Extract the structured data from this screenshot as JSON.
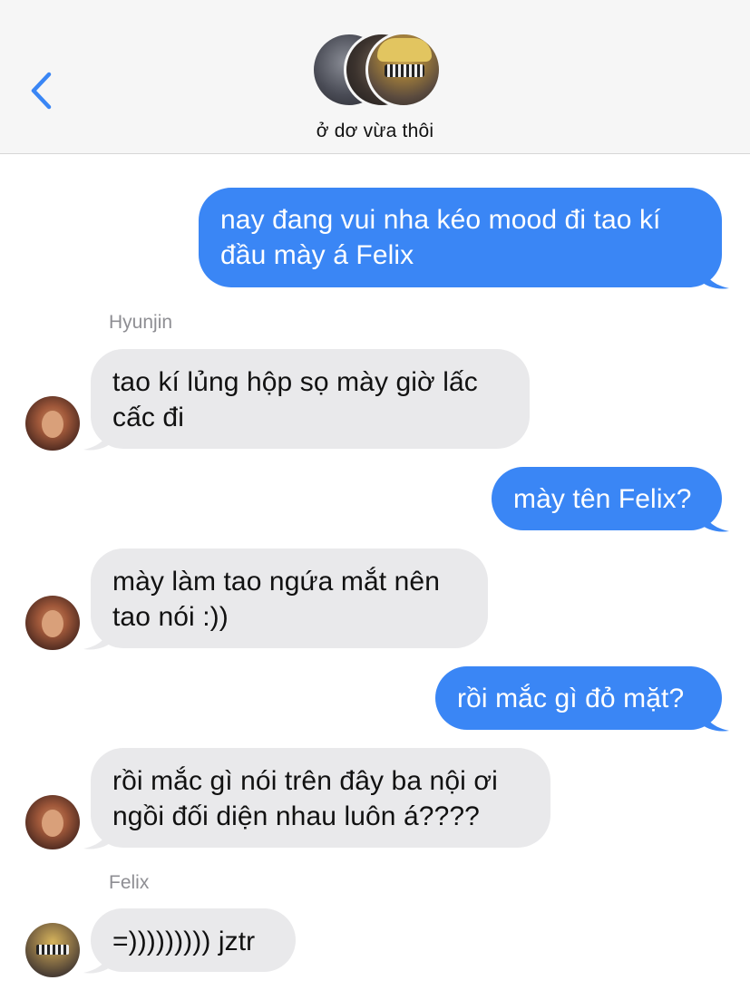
{
  "header": {
    "group_name": "ở dơ vừa thôi"
  },
  "colors": {
    "outgoing_bubble": "#3a86f5",
    "incoming_bubble": "#e9e9eb",
    "back_chevron": "#3a86f5"
  },
  "messages": [
    {
      "direction": "outgoing",
      "lines": [
        "nay đang vui nha kéo mood đi tao kí",
        "đầu mày á Felix"
      ]
    },
    {
      "direction": "incoming",
      "sender": "Hyunjin",
      "lines": [
        "tao kí lủng hộp sọ mày giờ lấc",
        "cấc đi"
      ]
    },
    {
      "direction": "outgoing",
      "lines": [
        "mày tên Felix?"
      ]
    },
    {
      "direction": "incoming",
      "lines": [
        "mày làm tao ngứa mắt nên",
        "tao nói :))"
      ]
    },
    {
      "direction": "outgoing",
      "lines": [
        "rồi mắc gì đỏ mặt?"
      ]
    },
    {
      "direction": "incoming",
      "lines": [
        "rồi mắc gì nói trên đây ba nội ơi",
        "ngồi đối diện nhau luôn á????"
      ]
    },
    {
      "direction": "incoming",
      "sender": "Felix",
      "lines": [
        "=))))))))) jztr"
      ]
    }
  ]
}
